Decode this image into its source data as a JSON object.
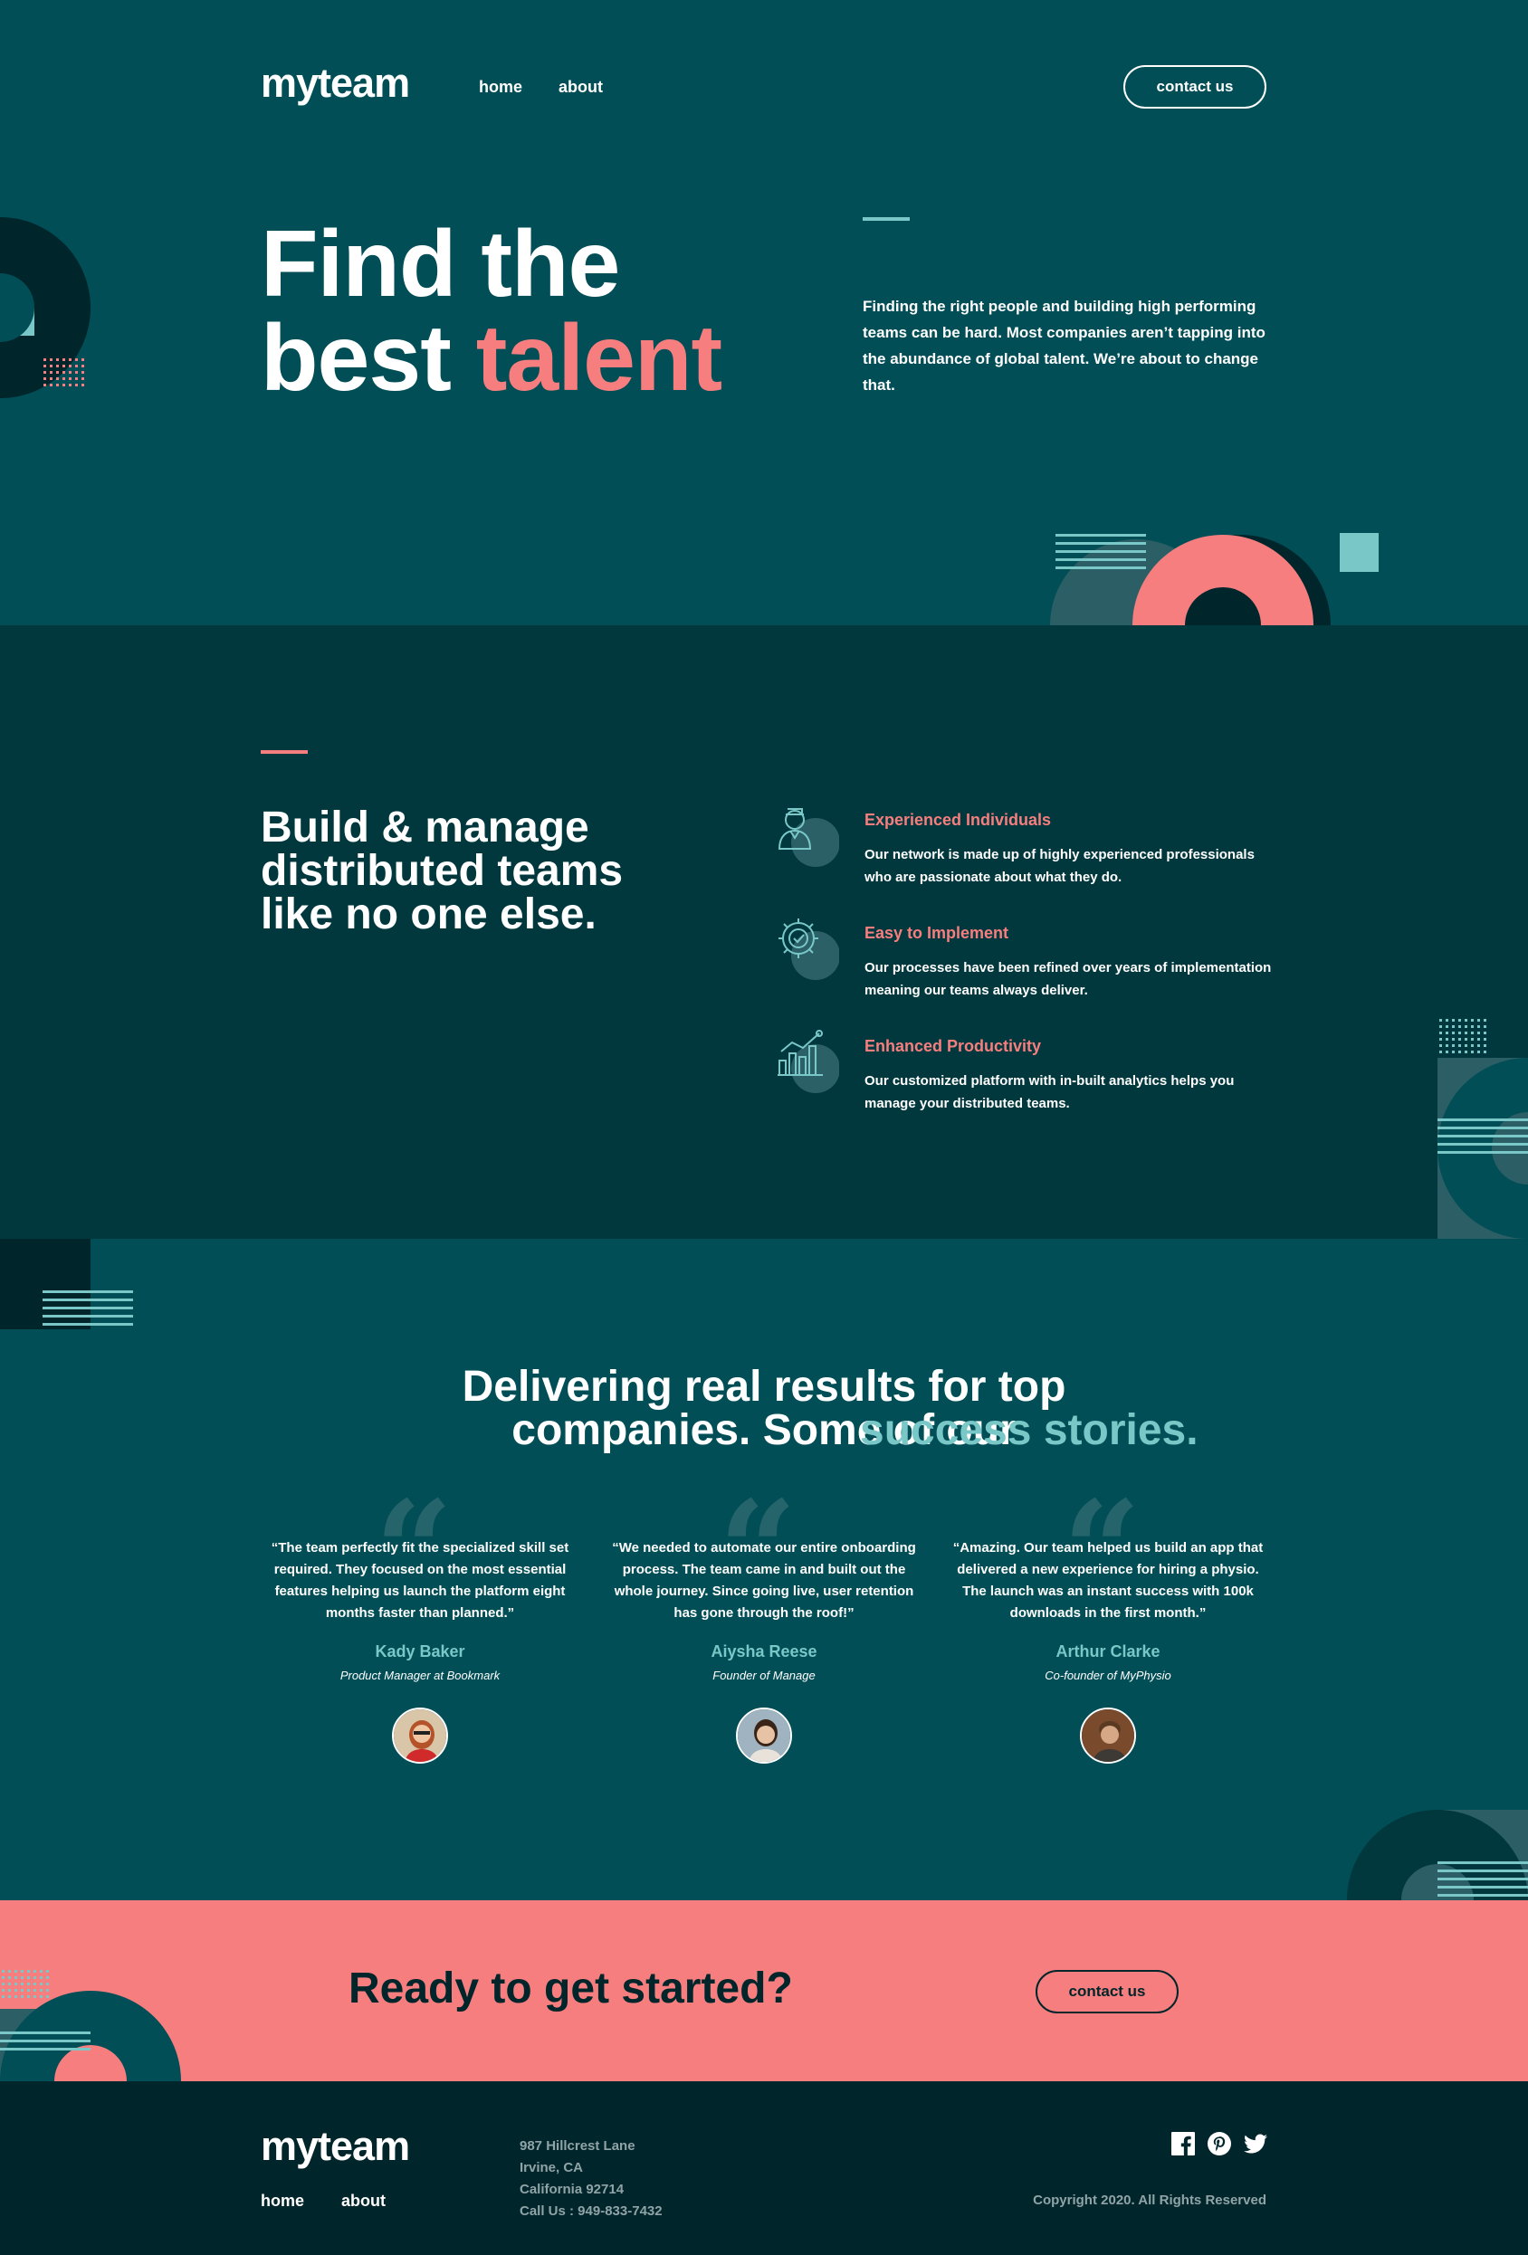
{
  "header": {
    "logo": "myteam",
    "nav": [
      {
        "label": "home"
      },
      {
        "label": "about"
      }
    ],
    "cta_label": "contact us"
  },
  "hero": {
    "title_line1": "Find the",
    "title_line2_plain": "best ",
    "title_line2_accent": "talent",
    "description": "Finding the right people and building high performing teams can be hard. Most companies aren’t tapping into the abundance of global talent. We’re about to change that."
  },
  "features": {
    "title": "Build & manage distributed teams like no one else.",
    "items": [
      {
        "icon": "person-icon",
        "heading": "Experienced Individuals",
        "text": "Our network is made up of highly experienced professionals who are passionate about what they do."
      },
      {
        "icon": "cog-check-icon",
        "heading": "Easy to Implement",
        "text": "Our processes have been refined over years of implementation meaning our teams always deliver."
      },
      {
        "icon": "chart-icon",
        "heading": "Enhanced Productivity",
        "text": "Our customized platform with in-built analytics helps you manage your distributed teams."
      }
    ]
  },
  "testimonials": {
    "title_plain": "Delivering real results for top companies. Some of our ",
    "title_accent": "success stories.",
    "items": [
      {
        "quote": "“The team perfectly fit the specialized skill set required. They focused on the most essential features helping us launch the platform eight months faster than planned.”",
        "name": "Kady Baker",
        "role": "Product Manager at Bookmark"
      },
      {
        "quote": "“We needed to automate our entire onboarding process. The team came in and built out the whole journey. Since going live, user retention has gone through the roof!”",
        "name": "Aiysha Reese",
        "role": "Founder of Manage"
      },
      {
        "quote": "“Amazing. Our team helped us build an app that delivered a new experience for hiring a physio. The launch was an instant success with 100k downloads in the first month.”",
        "name": "Arthur Clarke",
        "role": "Co-founder of MyPhysio"
      }
    ]
  },
  "cta": {
    "title": "Ready to get started?",
    "button_label": "contact us"
  },
  "footer": {
    "logo": "myteam",
    "nav": [
      {
        "label": "home"
      },
      {
        "label": "about"
      }
    ],
    "address": [
      "987 Hillcrest Lane",
      "Irvine, CA",
      "California 92714",
      "Call Us : 949-833-7432"
    ],
    "social": [
      "facebook-icon",
      "pinterest-icon",
      "twitter-icon"
    ],
    "copyright": "Copyright 2020. All Rights Reserved"
  },
  "colors": {
    "hero_bg": "#014e56",
    "features_bg": "#00383d",
    "footer_bg": "#00252a",
    "coral": "#f67e7e",
    "teal": "#79c8c7"
  }
}
